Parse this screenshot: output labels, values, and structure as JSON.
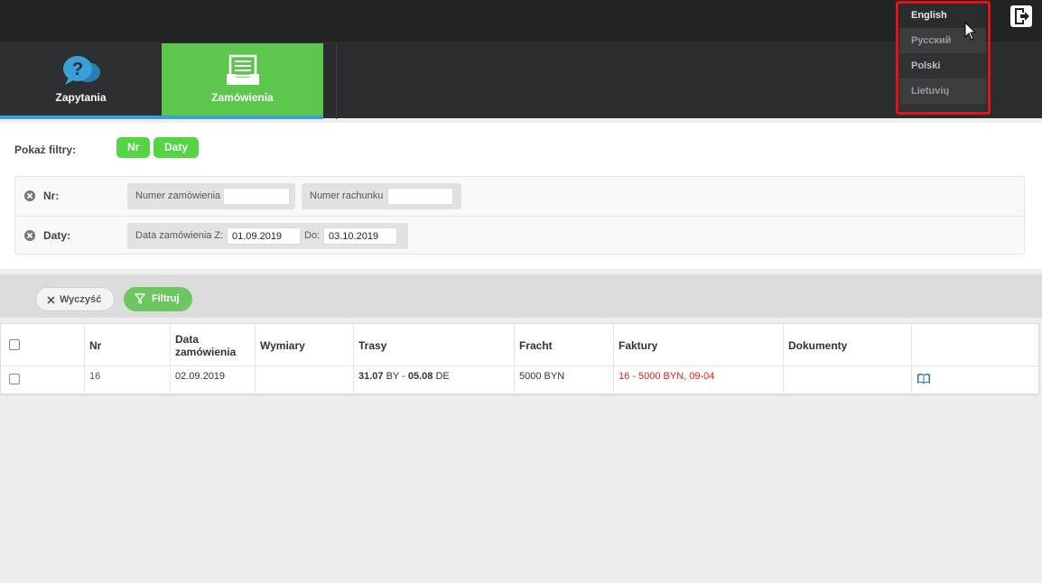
{
  "nav": {
    "tabs": [
      {
        "label": "Zapytania",
        "icon": "question-bubble-icon"
      },
      {
        "label": "Zamówienia",
        "icon": "orders-tray-icon"
      }
    ]
  },
  "languages": [
    "English",
    "Русский",
    "Polski",
    "Lietuvių"
  ],
  "filters": {
    "show_label": "Pokaż filtry:",
    "pills": [
      "Nr",
      "Daty"
    ],
    "nr": {
      "label": "Nr:",
      "order_number_label": "Numer zamówienia",
      "order_number_value": "",
      "invoice_number_label": "Numer rachunku",
      "invoice_number_value": ""
    },
    "dates": {
      "label": "Daty:",
      "from_label": "Data zamówienia Z:",
      "from_value": "01.09.2019",
      "to_label": "Do:",
      "to_value": "03.10.2019"
    }
  },
  "actions": {
    "clear": "Wyczyść",
    "filter": "Filtruj"
  },
  "table": {
    "headers": [
      "Nr",
      "Data zamówienia",
      "Wymiary",
      "Trasy",
      "Fracht",
      "Faktury",
      "Dokumenty"
    ],
    "rows": [
      {
        "nr": "16",
        "date": "02.09.2019",
        "dimensions": "",
        "route_from_date": "31.07",
        "route_from_country": "BY",
        "route_sep": "-",
        "route_to_date": "05.08",
        "route_to_country": "DE",
        "freight": "5000 BYN",
        "invoices": "16 - 5000 BYN, 09-04",
        "documents": "",
        "action_icon": "book-icon"
      }
    ]
  },
  "colors": {
    "accent_green": "#5ec64f",
    "nav_underline": "#3aa1d8",
    "highlight_red": "#e01515"
  }
}
